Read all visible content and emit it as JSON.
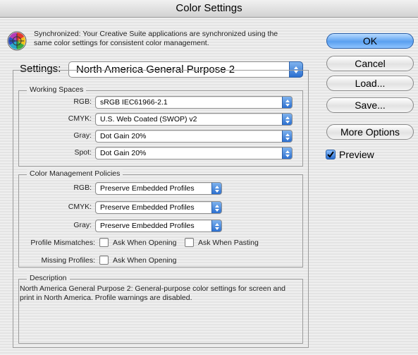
{
  "window": {
    "title": "Color Settings"
  },
  "sync": {
    "icon": "color-wheel-icon",
    "text": "Synchronized: Your Creative Suite applications are synchronized using the same color settings for consistent color management."
  },
  "settings": {
    "label": "Settings:",
    "value": "North America General Purpose 2"
  },
  "working_spaces": {
    "title": "Working Spaces",
    "rgb": {
      "label": "RGB:",
      "value": "sRGB IEC61966-2.1"
    },
    "cmyk": {
      "label": "CMYK:",
      "value": "U.S. Web Coated (SWOP) v2"
    },
    "gray": {
      "label": "Gray:",
      "value": "Dot Gain 20%"
    },
    "spot": {
      "label": "Spot:",
      "value": "Dot Gain 20%"
    }
  },
  "policies": {
    "title": "Color Management Policies",
    "rgb": {
      "label": "RGB:",
      "value": "Preserve Embedded Profiles"
    },
    "cmyk": {
      "label": "CMYK:",
      "value": "Preserve Embedded Profiles"
    },
    "gray": {
      "label": "Gray:",
      "value": "Preserve Embedded Profiles"
    },
    "mismatches_label": "Profile Mismatches:",
    "ask_opening": "Ask When Opening",
    "ask_pasting": "Ask When Pasting",
    "missing_label": "Missing Profiles:",
    "missing_ask_opening": "Ask When Opening"
  },
  "description": {
    "title": "Description",
    "text": "North America General Purpose 2:  General-purpose color settings for screen and print in North America. Profile warnings are disabled."
  },
  "buttons": {
    "ok": "OK",
    "cancel": "Cancel",
    "load": "Load...",
    "save": "Save...",
    "more_options": "More Options"
  },
  "preview": {
    "label": "Preview",
    "checked": true
  },
  "colors": {
    "accent": "#3d86e6",
    "group_border": "#9c9c9c"
  }
}
